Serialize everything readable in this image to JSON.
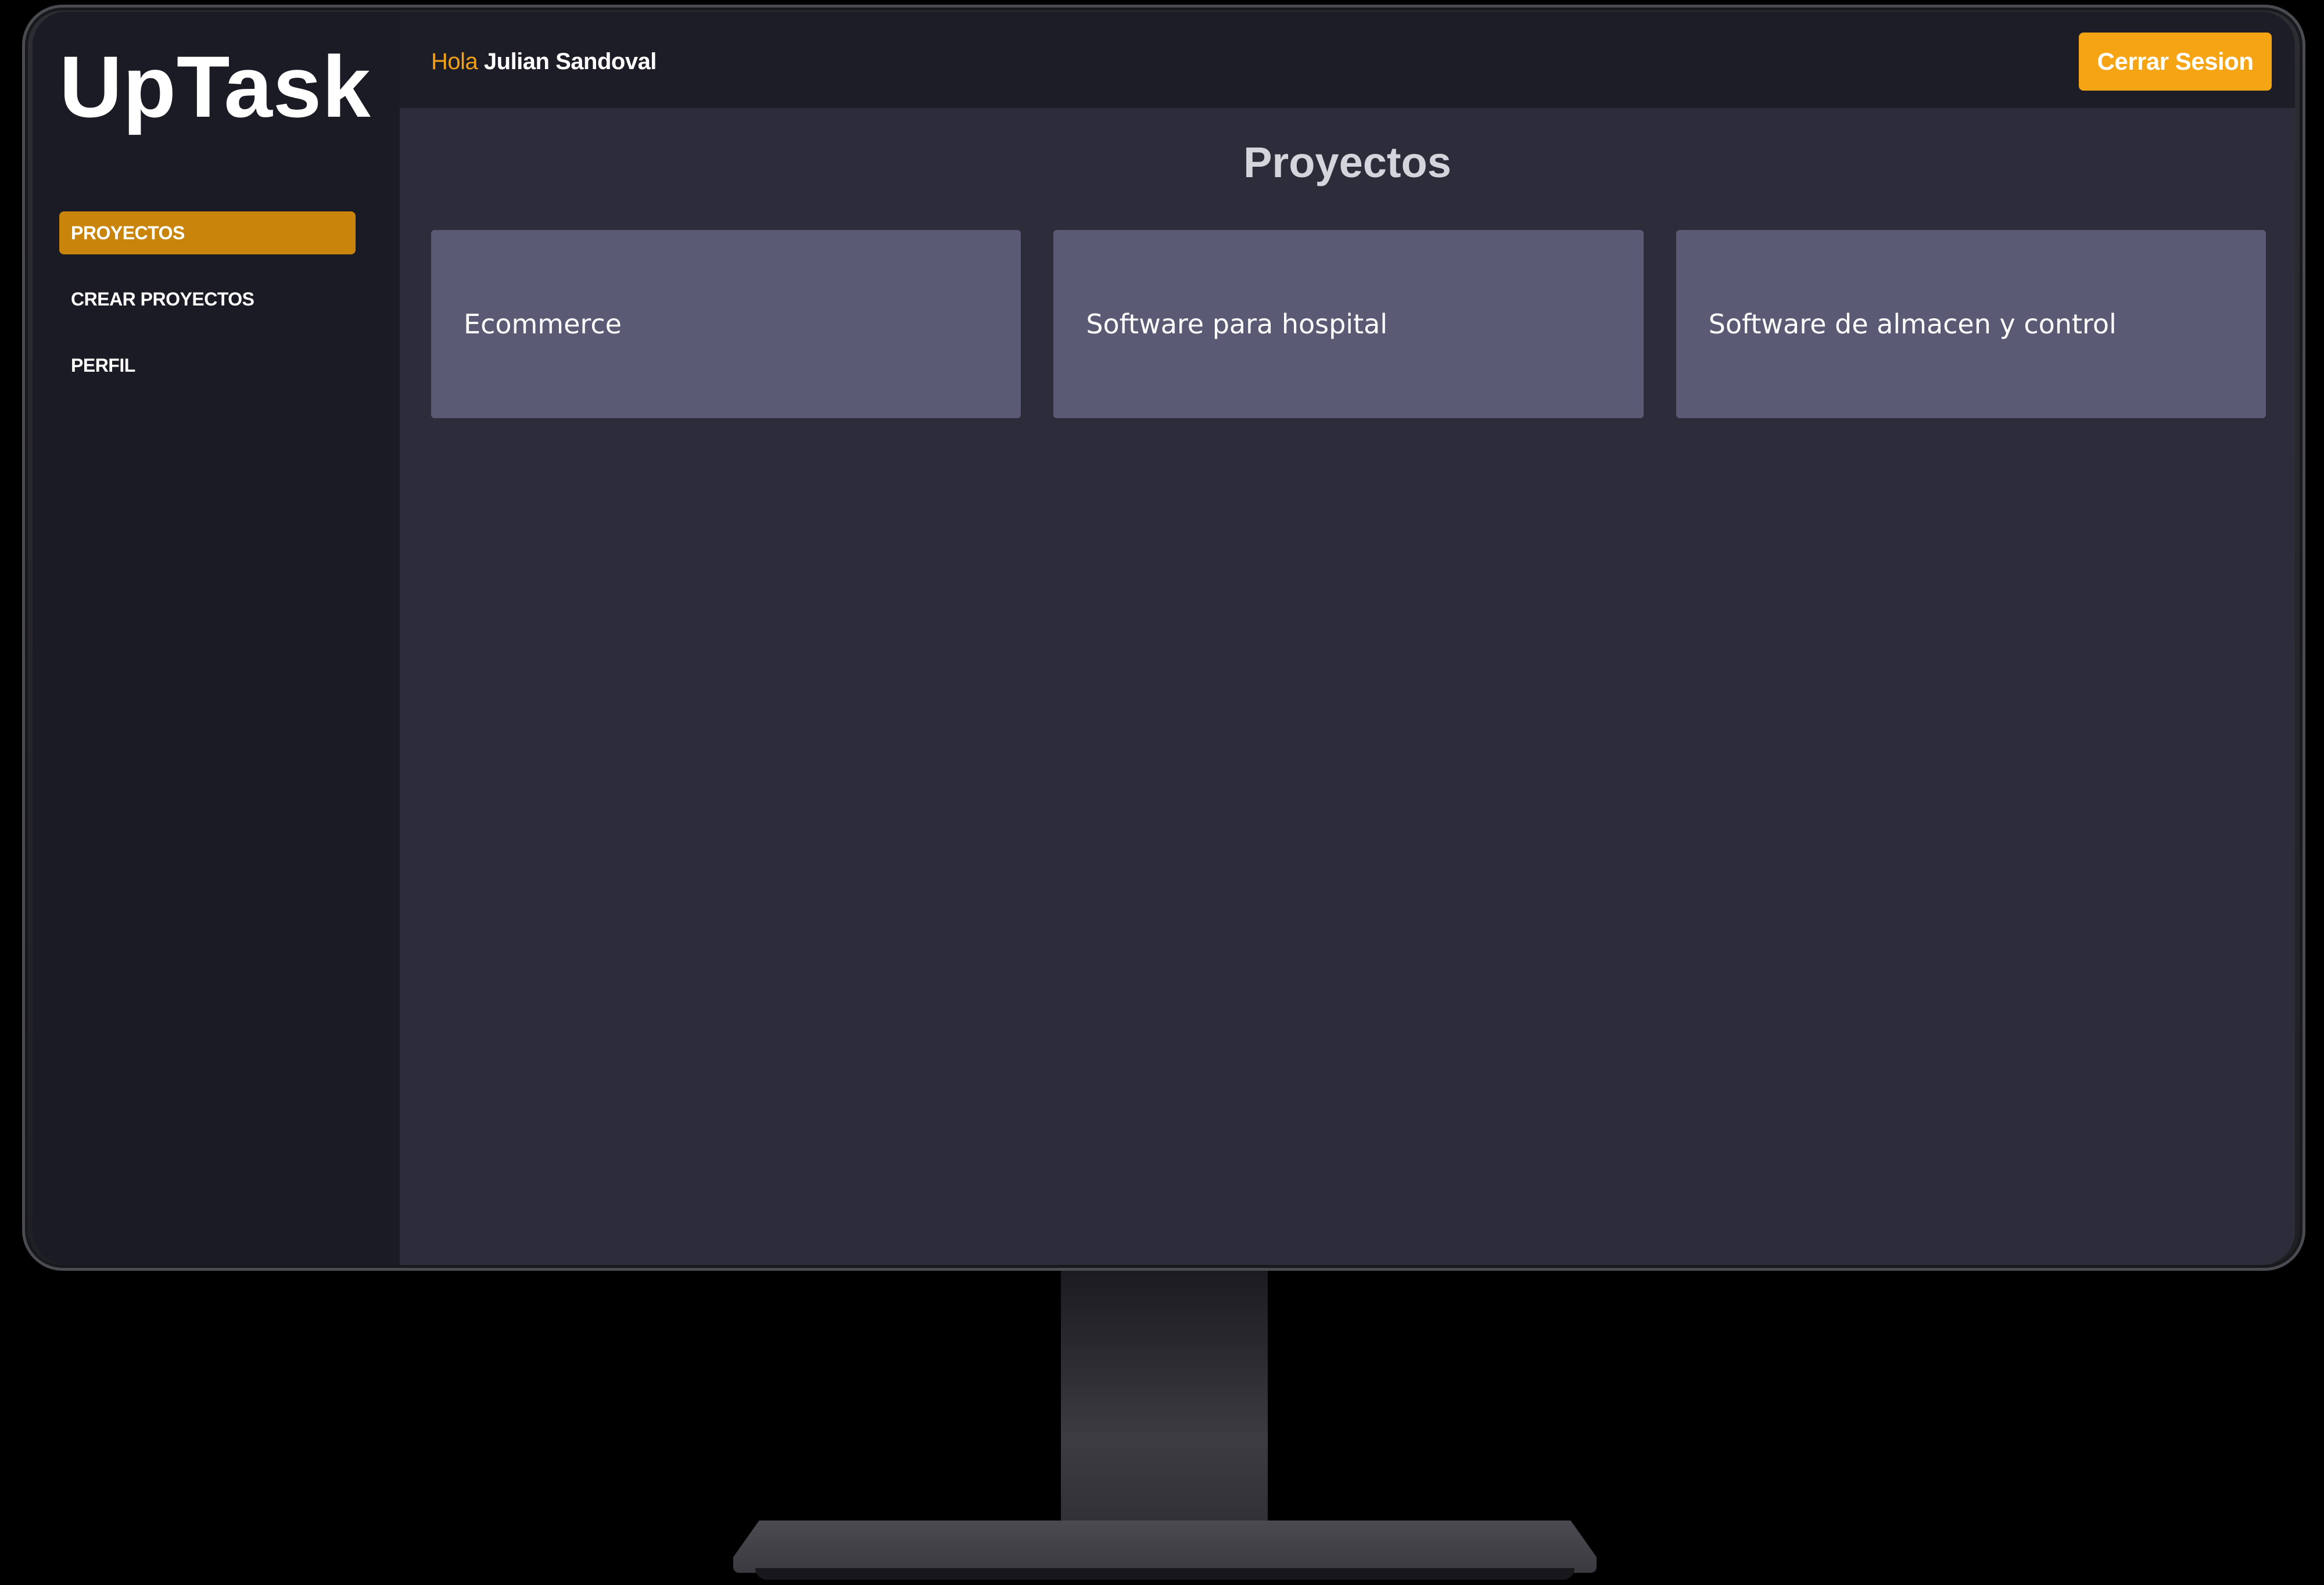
{
  "app": {
    "logo": "UpTask"
  },
  "sidebar": {
    "items": [
      {
        "label": "PROYECTOS",
        "active": true
      },
      {
        "label": "CREAR PROYECTOS",
        "active": false
      },
      {
        "label": "PERFIL",
        "active": false
      }
    ]
  },
  "header": {
    "greeting_prefix": "Hola",
    "user_name": "Julian Sandoval",
    "logout_label": "Cerrar Sesion"
  },
  "main": {
    "title": "Proyectos",
    "projects": [
      {
        "name": "Ecommerce"
      },
      {
        "name": "Software para hospital"
      },
      {
        "name": "Software de almacen y control"
      }
    ]
  },
  "colors": {
    "accent": "#f5a413",
    "active_nav": "#c9850b",
    "sidebar_bg": "#1b1b26",
    "content_bg": "#2c2c3a",
    "card_bg": "#5a5a74"
  }
}
